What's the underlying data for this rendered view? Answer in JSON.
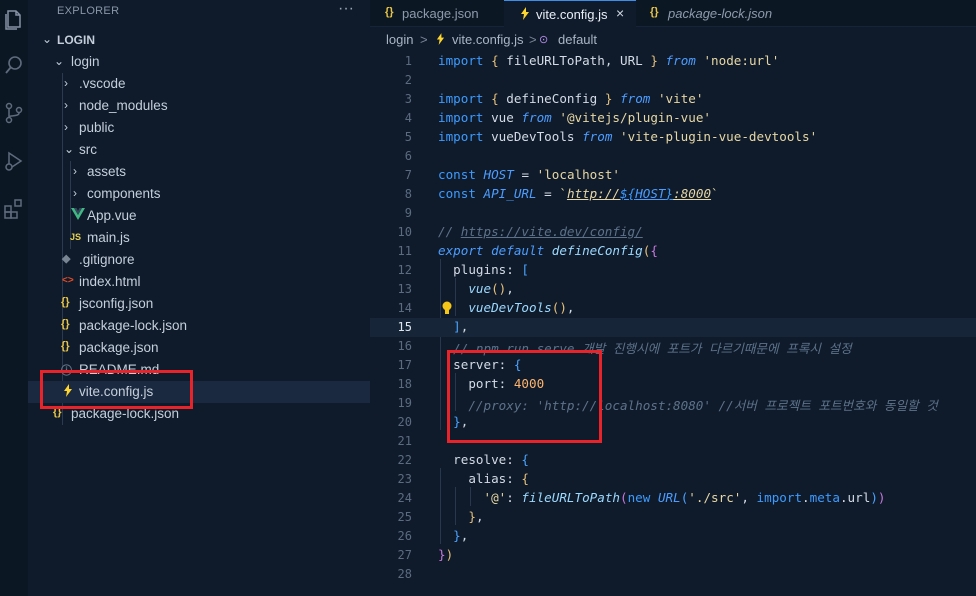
{
  "activity_bar": {
    "icons": [
      "files-icon",
      "search-icon",
      "source-control-icon",
      "run-debug-icon",
      "extensions-icon"
    ]
  },
  "sidebar": {
    "header": "EXPLORER",
    "more": "···",
    "root": "LOGIN",
    "items": [
      {
        "label": "login",
        "type": "folder-open"
      },
      {
        "label": ".vscode",
        "type": "folder"
      },
      {
        "label": "node_modules",
        "type": "folder"
      },
      {
        "label": "public",
        "type": "folder"
      },
      {
        "label": "src",
        "type": "folder-open"
      },
      {
        "label": "assets",
        "type": "folder"
      },
      {
        "label": "components",
        "type": "folder"
      },
      {
        "label": "App.vue",
        "type": "vue"
      },
      {
        "label": "main.js",
        "type": "js",
        "icon_text": "JS"
      },
      {
        "label": ".gitignore",
        "type": "git"
      },
      {
        "label": "index.html",
        "type": "html"
      },
      {
        "label": "jsconfig.json",
        "type": "json",
        "icon_text": "{}"
      },
      {
        "label": "package-lock.json",
        "type": "json",
        "icon_text": "{}"
      },
      {
        "label": "package.json",
        "type": "json",
        "icon_text": "{}"
      },
      {
        "label": "README.md",
        "type": "info"
      },
      {
        "label": "vite.config.js",
        "type": "vite"
      },
      {
        "label": "package-lock.json",
        "type": "json",
        "icon_text": "{}"
      }
    ]
  },
  "tabs": [
    {
      "label": "package.json",
      "icon_text": "{}"
    },
    {
      "label": "vite.config.js",
      "active": true,
      "close": "×"
    },
    {
      "label": "package-lock.json",
      "icon_text": "{}"
    }
  ],
  "breadcrumb": {
    "parts": [
      "login",
      ">",
      "vite.config.js",
      ">",
      "default"
    ]
  },
  "editor": {
    "current_line": 15,
    "line_numbers": [
      "1",
      "2",
      "3",
      "4",
      "5",
      "6",
      "7",
      "8",
      "9",
      "10",
      "11",
      "12",
      "13",
      "14",
      "15",
      "16",
      "17",
      "18",
      "19",
      "20",
      "21",
      "22",
      "23",
      "24",
      "25",
      "26",
      "27",
      "28"
    ]
  },
  "colors": {
    "accent": "#3b8eea",
    "highlight_box": "#e8232a",
    "keyword": "#3c9bff",
    "string": "#e6d7a4",
    "number": "#ffb46b"
  }
}
